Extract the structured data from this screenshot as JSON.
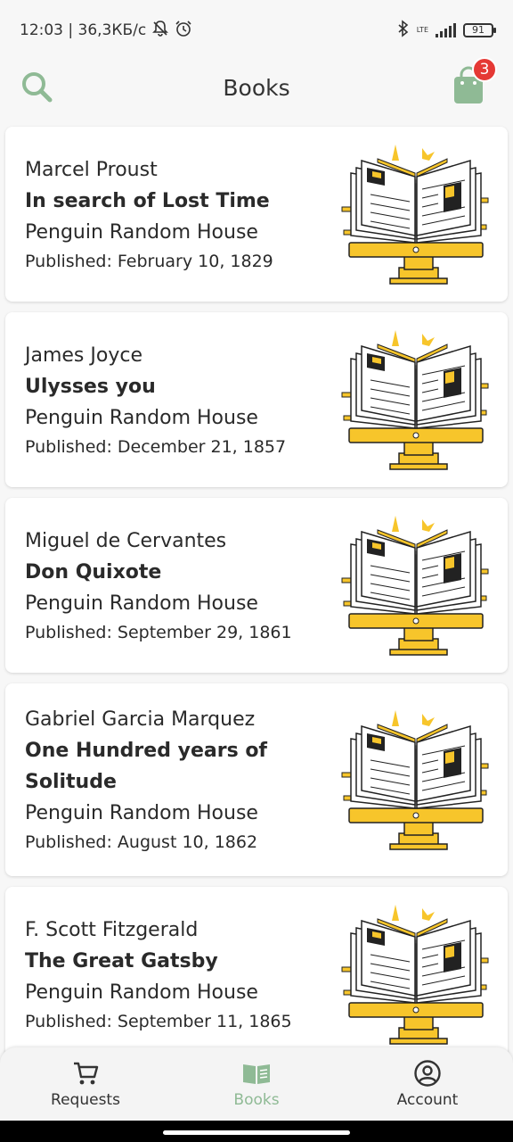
{
  "status_bar": {
    "time_speed": "12:03 | 36,3КБ/с",
    "network": "LTE",
    "battery": "91"
  },
  "app_bar": {
    "title": "Books",
    "cart_count": "3",
    "search_icon": "search-icon",
    "cart_icon": "shopping-bag-icon"
  },
  "colors": {
    "accent": "#8fba95",
    "badge": "#e53935",
    "illustration_yellow": "#f7c52b"
  },
  "books": [
    {
      "author": "Marcel Proust",
      "title": "In search of Lost Time",
      "publisher": "Penguin Random House",
      "published": "Published: February 10, 1829"
    },
    {
      "author": "James Joyce",
      "title": "Ulysses you",
      "publisher": "Penguin Random House",
      "published": "Published: December 21, 1857"
    },
    {
      "author": "Miguel de Cervantes",
      "title": "Don Quixote",
      "publisher": "Penguin Random House",
      "published": "Published: September 29, 1861"
    },
    {
      "author": "Gabriel Garcia Marquez",
      "title": "One Hundred years of Solitude",
      "publisher": "Penguin Random House",
      "published": "Published: August 10, 1862"
    },
    {
      "author": "F. Scott Fitzgerald",
      "title": "The Great Gatsby",
      "publisher": "Penguin Random House",
      "published": "Published: September 11, 1865"
    }
  ],
  "bottom_nav": [
    {
      "label": "Requests",
      "icon": "cart-icon"
    },
    {
      "label": "Books",
      "icon": "book-icon",
      "active": true
    },
    {
      "label": "Account",
      "icon": "account-icon"
    }
  ]
}
